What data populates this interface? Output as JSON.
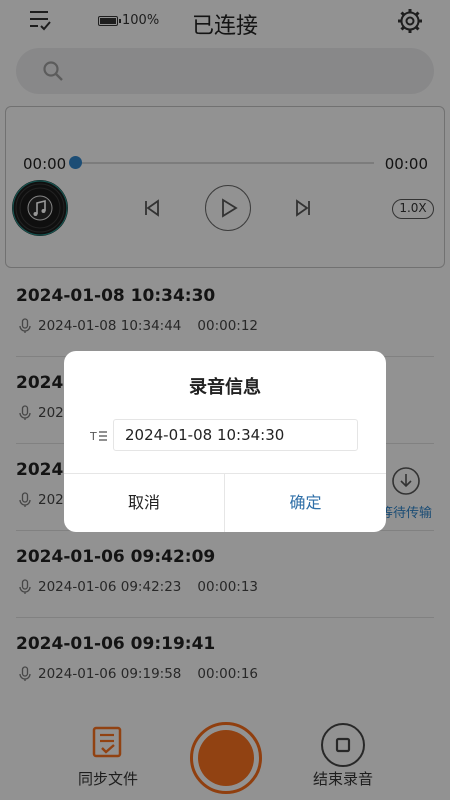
{
  "header": {
    "battery": "100%",
    "title": "已连接"
  },
  "player": {
    "time_current": "00:00",
    "time_total": "00:00",
    "progress": 0,
    "speed": "1.0X"
  },
  "recordings": [
    {
      "title": "2024-01-08 10:34:30",
      "date": "2024-01-08 10:34:44",
      "duration": "00:00:12"
    },
    {
      "title": "2024-",
      "date": "202",
      "duration": ""
    },
    {
      "title": "2024-",
      "date": "202",
      "duration": "",
      "download_label": "等待传输"
    },
    {
      "title": "2024-01-06 09:42:09",
      "date": "2024-01-06 09:42:23",
      "duration": "00:00:13"
    },
    {
      "title": "2024-01-06 09:19:41",
      "date": "2024-01-06 09:19:58",
      "duration": "00:00:16"
    }
  ],
  "bottom": {
    "sync_label": "同步文件",
    "stop_label": "结束录音"
  },
  "dialog": {
    "title": "录音信息",
    "input_value": "2024-01-08 10:34:30",
    "cancel": "取消",
    "confirm": "确定"
  },
  "colors": {
    "accent_blue": "#2f80c4",
    "record_orange": "#f26f1e"
  }
}
